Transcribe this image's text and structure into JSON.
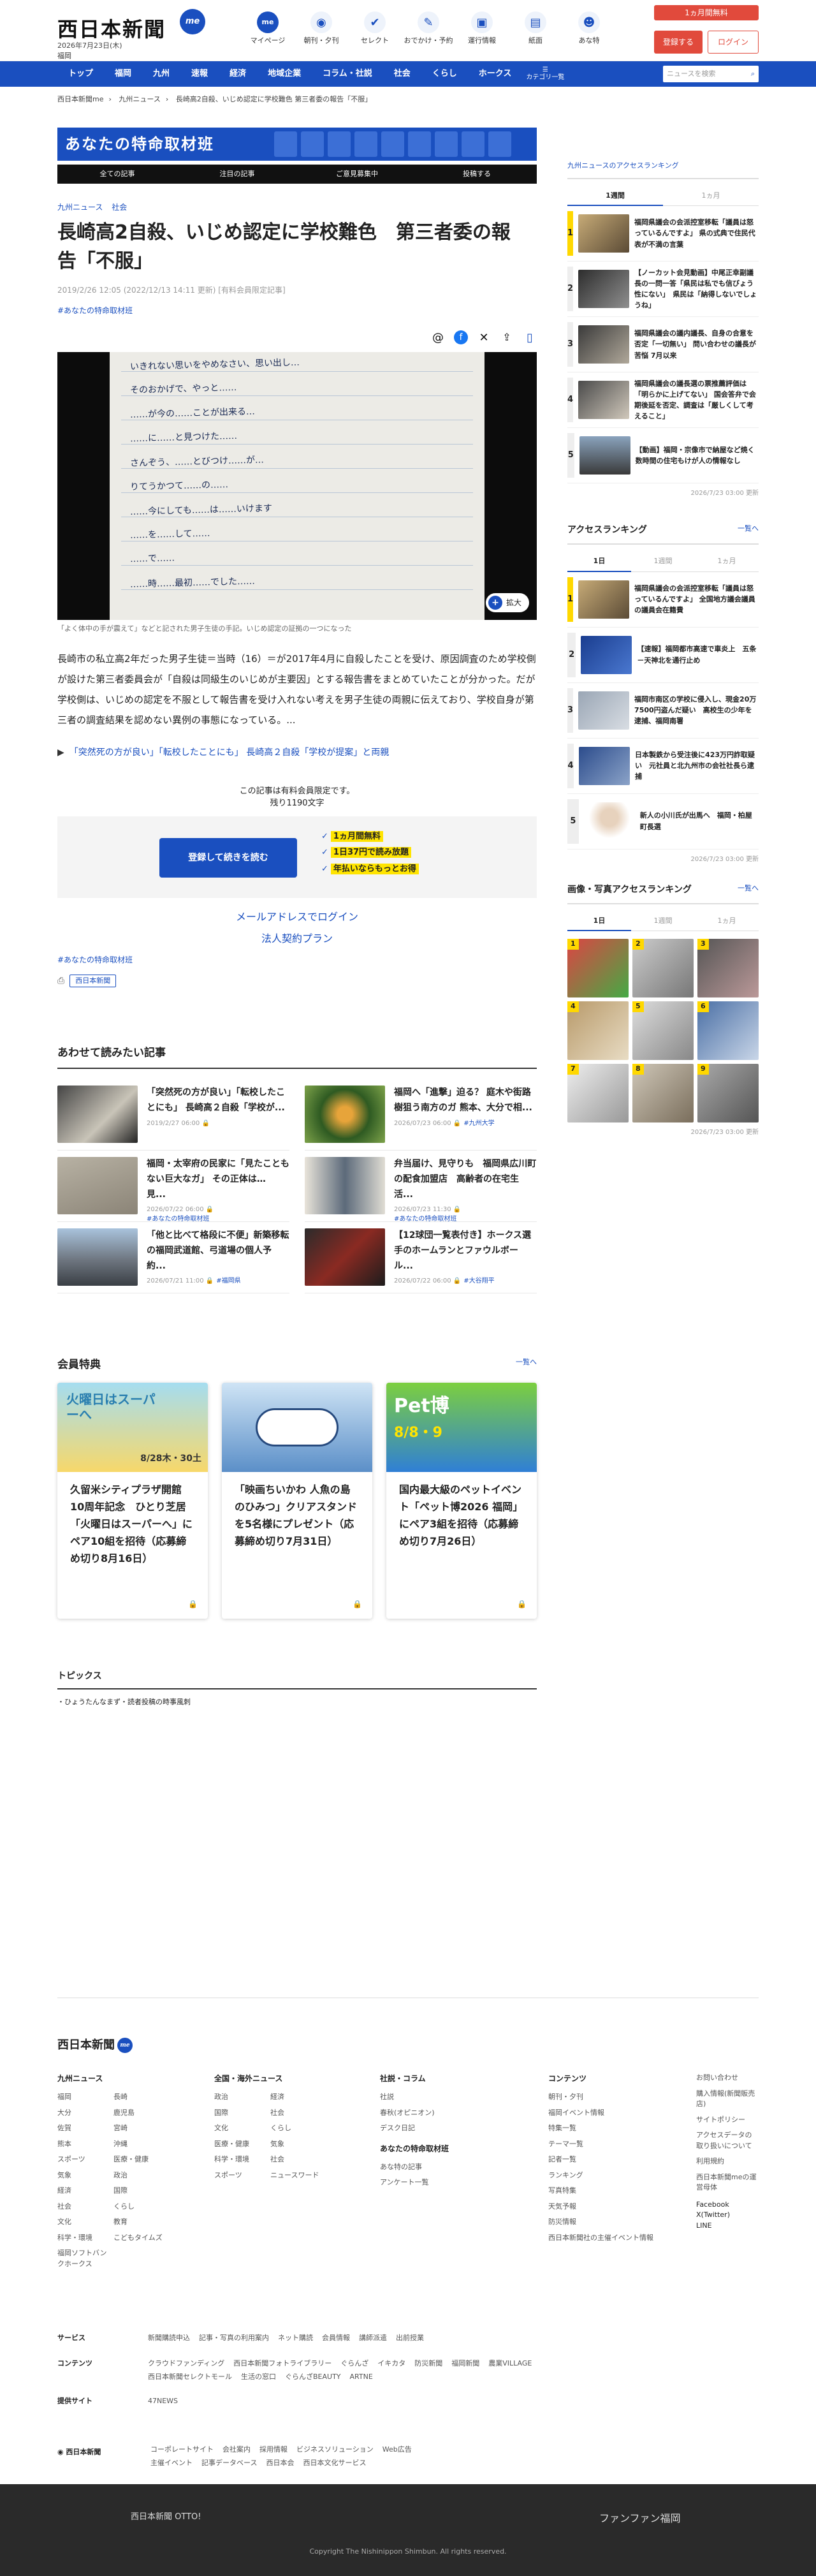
{
  "header": {
    "logo": "西日本新聞",
    "logo_me": "me",
    "date": "2026年7月23日(木)",
    "nav": [
      {
        "icon": "me-icon",
        "label": "マイページ"
      },
      {
        "icon": "newspaper-icon",
        "label": "朝刊・夕刊"
      },
      {
        "icon": "select-icon",
        "label": "セレクト"
      },
      {
        "icon": "outing-icon",
        "label": "おでかけ・予約"
      },
      {
        "icon": "train-icon",
        "label": "運行情報"
      },
      {
        "icon": "paper-icon",
        "label": "紙面"
      },
      {
        "icon": "animal-icon",
        "label": "あな特"
      }
    ],
    "trial": "1ヵ月間無料",
    "register": "登録する",
    "login": "ログイン",
    "region": "福岡"
  },
  "gnav": {
    "items": [
      "トップ",
      "福岡",
      "九州",
      "速報",
      "経済",
      "地域企業",
      "コラム・社説",
      "社会",
      "くらし",
      "ホークス"
    ],
    "category": "カテゴリ一覧",
    "search_placeholder": "ニュースを検索"
  },
  "breadcrumb": [
    "西日本新聞me",
    "九州ニュース",
    "長崎高2自殺、いじめ認定に学校難色 第三者委の報告「不服」"
  ],
  "banner": {
    "title": "あなたの特命取材班",
    "menu": [
      "全ての記事",
      "注目の記事",
      "ご意見募集中",
      "投稿する"
    ]
  },
  "article": {
    "categories": [
      "九州ニュース",
      "社会"
    ],
    "title": "長崎高2自殺、いじめ認定に学校難色　第三者委の報告「不服」",
    "meta": "2019/2/26 12:05 (2022/12/13 14:11 更新) [有料会員限定記事]",
    "tag": "#あなたの特命取材班",
    "zoom": "拡大",
    "caption": "「よく体中の手が震えて」などと記された男子生徒の手記。いじめ認定の証拠の一つになった",
    "lead": "長崎市の私立高2年だった男子生徒＝当時（16）＝が2017年4月に自殺したことを受け、原因調査のため学校側が設けた第三者委員会が「自殺は同級生のいじめが主要因」とする報告書をまとめていたことが分かった。だが学校側は、いじめの認定を不服として報告書を受け入れない考えを男子生徒の両親に伝えており、学校自身が第三者の調査結果を認めない異例の事態になっている。...",
    "related": "「突然死の方が良い」「転校したことにも」 長崎高２自殺「学校が提案」と両親",
    "paid1": "この記事は有料会員限定です。",
    "paid2": "残り1190文字",
    "cta": "登録して続きを読む",
    "benefits": [
      {
        "mark": "✓",
        "text": "1ヵ月間無料"
      },
      {
        "mark": "✓",
        "text": "1日37円で読み放題"
      },
      {
        "mark": "✓",
        "text": "年払いならもっとお得"
      }
    ],
    "mail_login": "メールアドレスでログイン",
    "corp": "法人契約プラン",
    "tag2": "#あなたの特命取材班",
    "badge": "西日本新聞"
  },
  "also": {
    "heading": "あわせて読みたい記事",
    "items": [
      {
        "title": "「突然死の方が良い」「転校したことにも」 長崎高２自殺「学校が...",
        "meta": "2019/2/27 06:00",
        "tag": ""
      },
      {
        "title": "福岡へ「進撃」迫る？ 庭木や街路樹狙う南方のガ 熊本、大分で相...",
        "meta": "2026/07/23 06:00",
        "tag": "#九州大学"
      },
      {
        "title": "福岡・太宰府の民家に「見たこともない巨大なガ」 その正体は…　見...",
        "meta": "2026/07/22 06:00",
        "tag": "#あなたの特命取材班"
      },
      {
        "title": "弁当届け、見守りも　福岡県広川町の配食加盟店　高齢者の在宅生活...",
        "meta": "2026/07/23 11:30",
        "tag": "#あなたの特命取材班"
      },
      {
        "title": "「他と比べて格段に不便」新築移転の福岡武道館、弓道場の個人予約...",
        "meta": "2026/07/21 11:00",
        "tag": "#福岡県"
      },
      {
        "title": "【12球団一覧表付き】ホークス選手のホームランとファウルボール...",
        "meta": "2026/07/22 06:00",
        "tag": "#大谷翔平"
      }
    ]
  },
  "member": {
    "heading": "会員特典",
    "more": "一覧へ",
    "items": [
      {
        "title": "久留米シティプラザ開館10周年記念　ひとり芝居「火曜日はスーパーへ」にペア10組を招待（応募締め切り8月16日）",
        "img": "火曜日はスーパーへ",
        "date": "8/28木・30土"
      },
      {
        "title": "「映画ちいかわ 人魚の島のひみつ」クリアスタンドを5名様にプレゼント（応募締め切り7月31日）",
        "img": "",
        "date": ""
      },
      {
        "title": "国内最大級のペットイベント「ペット博2026 福岡」にペア3組を招待（応募締め切り7月26日）",
        "img": "Pet博",
        "date": "8/8・9"
      }
    ]
  },
  "topics": {
    "heading": "トピックス",
    "items": [
      "ひょうたんなまず・読者投稿の時事風刺"
    ]
  },
  "side": {
    "kyushu": {
      "heading": "九州ニュースのアクセスランキング",
      "tabs": [
        "1週間",
        "1ヵ月"
      ],
      "items": [
        {
          "n": "1",
          "t": "福岡県議会の会派控室移転「議員は怒っているんですよ」 県の式典で住民代表が不満の言葉"
        },
        {
          "n": "2",
          "t": "【ノーカット会見動画】中尾正幸副議長の一問一答「県民は私でも信びょう性にない」　県民は「納得しないでしょうね」"
        },
        {
          "n": "3",
          "t": "福岡県議会の議内議長、自身の合意を否定「一切無い」 問い合わせの議長が苦悩 7月以来"
        },
        {
          "n": "4",
          "t": "福岡県議会の議長選の票推薦評価は 「明らかに上げてない」 国会答弁で会期後延を否定、調査は「厳しくして考えること」"
        },
        {
          "n": "5",
          "t": "【動画】福岡・宗像市で納屋など焼く　数時間の住宅もけが人の情報なし"
        }
      ],
      "updated": "2026/7/23 03:00 更新"
    },
    "access": {
      "heading": "アクセスランキング",
      "more": "一覧へ",
      "tabs": [
        "1日",
        "1週間",
        "1ヵ月"
      ],
      "items": [
        {
          "n": "1",
          "t": "福岡県議会の会派控室移転「議員は怒っているんですよ」 全国地方議会議員の議員会在籍費"
        },
        {
          "n": "2",
          "t": "【速報】福岡都市高速で車炎上　五条－天神北を通行止め"
        },
        {
          "n": "3",
          "t": "福岡市南区の学校に侵入し、現金20万7500円盗んだ疑い　高校生の少年を逮捕、福岡南署"
        },
        {
          "n": "4",
          "t": "日本製鉄から受注後に423万円詐取疑い　元社員と北九州市の会社社長ら逮捕"
        },
        {
          "n": "5",
          "t": "新人の小川氏が出馬へ　福岡・柏屋町長選"
        }
      ],
      "updated": "2026/7/23 03:00 更新"
    },
    "photo": {
      "heading": "画像・写真アクセスランキング",
      "more": "一覧へ",
      "tabs": [
        "1日",
        "1週間",
        "1ヵ月"
      ],
      "items": [
        "1",
        "2",
        "3",
        "4",
        "5",
        "6",
        "7",
        "8",
        "9"
      ],
      "updated": "2026/7/23 03:00 更新"
    }
  },
  "footer": {
    "logo": "西日本新聞",
    "logo_me": "me",
    "kyushu": {
      "h": "九州ニュース",
      "items": [
        "福岡",
        "長崎",
        "大分",
        "鹿児島",
        "佐賀",
        "宮崎",
        "熊本",
        "沖縄",
        "スポーツ",
        "医療・健康",
        "気象",
        "政治",
        "経済",
        "国際",
        "社会",
        "くらし",
        "文化",
        "教育",
        "科学・環境",
        "こどもタイムズ",
        "福岡ソフトバンクホークス"
      ]
    },
    "national": {
      "h": "全国・海外ニュース",
      "items": [
        "政治",
        "経済",
        "国際",
        "社会",
        "文化",
        "くらし",
        "医療・健康",
        "気象",
        "科学・環境",
        "社会",
        "スポーツ",
        "ニュースワード"
      ]
    },
    "column": {
      "h": "社説・コラム",
      "items": [
        "社説",
        "春秋(オピニオン)",
        "デスク日記"
      ],
      "h2": "あなたの特命取材班",
      "items2": [
        "あな特の記事",
        "アンケート一覧"
      ]
    },
    "contents": {
      "h": "コンテンツ",
      "items": [
        "朝刊・夕刊",
        "福岡イベント情報",
        "特集一覧",
        "テーマ一覧",
        "記者一覧",
        "ランキング",
        "写真特集",
        "天気予報",
        "防災情報",
        "西日本新聞社の主催イベント情報"
      ]
    },
    "misc": {
      "items": [
        "お問い合わせ",
        "購入情報(新聞販売店)",
        "サイトポリシー",
        "アクセスデータの取り扱いについて",
        "利用規約",
        "西日本新聞meの運営母体"
      ],
      "sns": [
        "Facebook",
        "X(Twitter)",
        "LINE"
      ]
    },
    "service": {
      "h": "サービス",
      "items": [
        "新聞購読申込",
        "記事・写真の利用案内",
        "ネット購読",
        "会員情報",
        "講師派遣",
        "出前授業"
      ]
    },
    "contents2": {
      "h": "コンテンツ",
      "items": [
        "クラウドファンディング",
        "西日本新聞フォトライブラリー",
        "ぐらんざ",
        "イキカタ",
        "防災新聞",
        "福岡新聞",
        "農業VILLAGE",
        "西日本新聞セレクトモール",
        "生活の窓口",
        "ぐらんざBEAUTY",
        "ARTNE"
      ]
    },
    "provider": {
      "h": "提供サイト",
      "items": [
        "47NEWS"
      ]
    },
    "bottom": [
      "コーポレートサイト",
      "会社案内",
      "採用情報",
      "ビジネスソリューション",
      "Web広告",
      "主催イベント",
      "記事データベース",
      "西日本会",
      "西日本文化サービス"
    ],
    "dark_left": "西日本新聞 OTTO!",
    "dark_right": "ファンファン福岡",
    "copyright": "Copyright The Nishinippon Shimbun. All rights reserved."
  },
  "colors": {
    "brand": "#1a4fbf",
    "accent": "#e14a3c",
    "highlight": "#ffe400"
  }
}
